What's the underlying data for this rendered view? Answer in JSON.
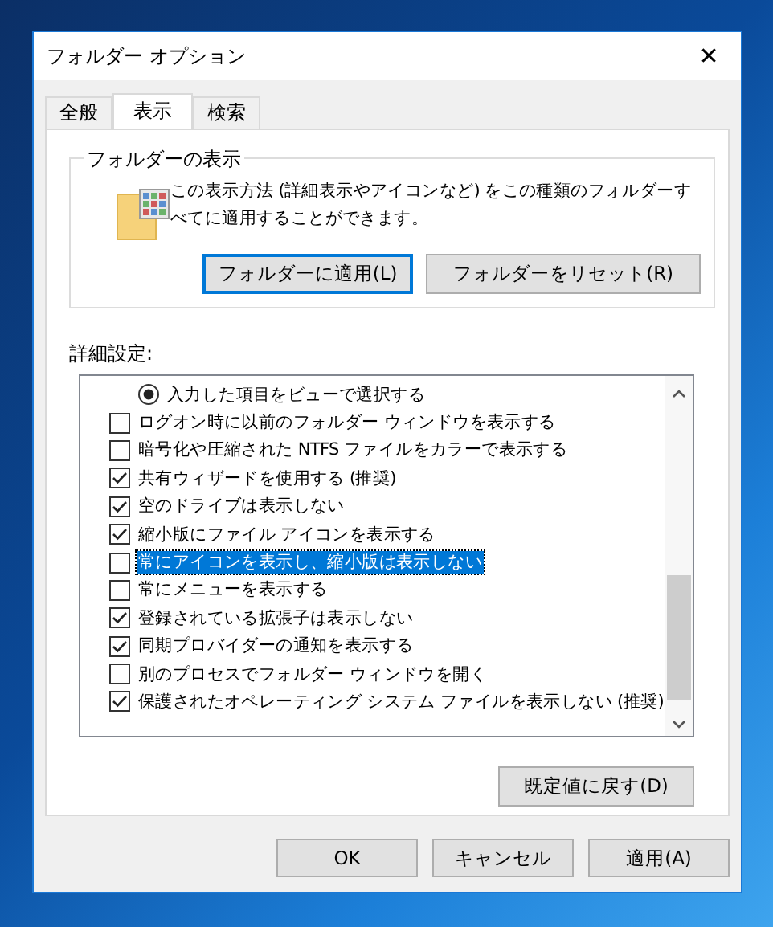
{
  "window": {
    "title": "フォルダー オプション",
    "close": "✕"
  },
  "tabs": [
    {
      "label": "全般",
      "selected": false
    },
    {
      "label": "表示",
      "selected": true
    },
    {
      "label": "検索",
      "selected": false
    }
  ],
  "folder_views": {
    "title": "フォルダーの表示",
    "description": "この表示方法 (詳細表示やアイコンなど) をこの種類のフォルダーすべてに適用することができます。",
    "buttons": [
      {
        "label": "フォルダーに適用(L)",
        "focused": true
      },
      {
        "label": "フォルダーをリセット(R)",
        "focused": false
      }
    ]
  },
  "advanced": {
    "label": "詳細設定:",
    "items": [
      {
        "kind": "radio",
        "label": "入力した項目をビューで選択する",
        "checked": true,
        "selected": false
      },
      {
        "kind": "checkbox",
        "label": "ログオン時に以前のフォルダー ウィンドウを表示する",
        "checked": false,
        "selected": false
      },
      {
        "kind": "checkbox",
        "label": "暗号化や圧縮された NTFS ファイルをカラーで表示する",
        "checked": false,
        "selected": false
      },
      {
        "kind": "checkbox",
        "label": "共有ウィザードを使用する (推奨)",
        "checked": true,
        "selected": false
      },
      {
        "kind": "checkbox",
        "label": "空のドライブは表示しない",
        "checked": true,
        "selected": false
      },
      {
        "kind": "checkbox",
        "label": "縮小版にファイル アイコンを表示する",
        "checked": true,
        "selected": false
      },
      {
        "kind": "checkbox",
        "label": "常にアイコンを表示し、縮小版は表示しない",
        "checked": false,
        "selected": true
      },
      {
        "kind": "checkbox",
        "label": "常にメニューを表示する",
        "checked": false,
        "selected": false
      },
      {
        "kind": "checkbox",
        "label": "登録されている拡張子は表示しない",
        "checked": true,
        "selected": false
      },
      {
        "kind": "checkbox",
        "label": "同期プロバイダーの通知を表示する",
        "checked": true,
        "selected": false
      },
      {
        "kind": "checkbox",
        "label": "別のプロセスでフォルダー ウィンドウを開く",
        "checked": false,
        "selected": false
      },
      {
        "kind": "checkbox",
        "label": "保護されたオペレーティング システム ファイルを表示しない (推奨)",
        "checked": true,
        "selected": false
      }
    ],
    "restore_button": "既定値に戻す(D)"
  },
  "buttons": [
    "OK",
    "キャンセル",
    "適用(A)"
  ]
}
